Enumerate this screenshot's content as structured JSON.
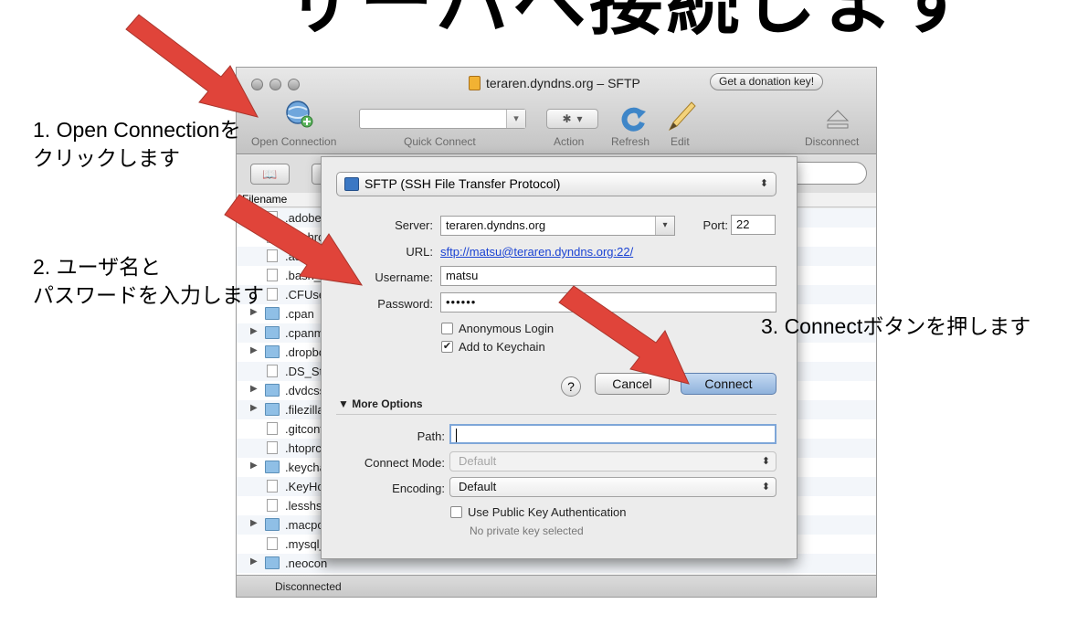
{
  "slide": {
    "title": "サーバへ接続します"
  },
  "annotations": {
    "step1": "1. Open Connectionを\nクリックします",
    "step2": "2. ユーザ名と\nパスワードを入力します",
    "step3": "3. Connectボタンを押します"
  },
  "window": {
    "title": "teraren.dyndns.org – SFTP",
    "donation_button": "Get a donation key!",
    "toolbar": {
      "open_connection": "Open Connection",
      "quick_connect": "Quick Connect",
      "action": "Action",
      "refresh": "Refresh",
      "edit": "Edit",
      "disconnect": "Disconnect"
    },
    "column_header": "Filename",
    "files": [
      {
        "name": ".adobe",
        "type": "file"
      },
      {
        "name": ".bashrc",
        "type": "file"
      },
      {
        "name": ".as",
        "type": "file"
      },
      {
        "name": ".bash_history",
        "type": "file"
      },
      {
        "name": ".CFUserTextEncoding",
        "type": "file"
      },
      {
        "name": ".cpan",
        "type": "folder"
      },
      {
        "name": ".cpanm",
        "type": "folder"
      },
      {
        "name": ".dropbox",
        "type": "folder"
      },
      {
        "name": ".DS_Store",
        "type": "file"
      },
      {
        "name": ".dvdcss",
        "type": "folder"
      },
      {
        "name": ".filezilla",
        "type": "folder"
      },
      {
        "name": ".gitconfig",
        "type": "file"
      },
      {
        "name": ".htoprc",
        "type": "file"
      },
      {
        "name": ".keychain",
        "type": "folder"
      },
      {
        "name": ".KeyHoles",
        "type": "file"
      },
      {
        "name": ".lesshst",
        "type": "file"
      },
      {
        "name": ".macports",
        "type": "folder"
      },
      {
        "name": ".mysql_history",
        "type": "file"
      },
      {
        "name": ".neocon",
        "type": "folder"
      }
    ],
    "status": "Disconnected"
  },
  "dialog": {
    "protocol": "SFTP (SSH File Transfer Protocol)",
    "server_label": "Server:",
    "server_value": "teraren.dyndns.org",
    "port_label": "Port:",
    "port_value": "22",
    "url_label": "URL:",
    "url_value": "sftp://matsu@teraren.dyndns.org:22/",
    "username_label": "Username:",
    "username_value": "matsu",
    "password_label": "Password:",
    "password_value": "••••••",
    "anonymous_login": "Anonymous Login",
    "add_to_keychain": "Add to Keychain",
    "help": "?",
    "cancel": "Cancel",
    "connect": "Connect",
    "more_options": "More Options",
    "path_label": "Path:",
    "path_value": "",
    "connect_mode_label": "Connect Mode:",
    "connect_mode_value": "Default",
    "encoding_label": "Encoding:",
    "encoding_value": "Default",
    "public_key_auth": "Use Public Key Authentication",
    "no_private_key": "No private key selected"
  }
}
